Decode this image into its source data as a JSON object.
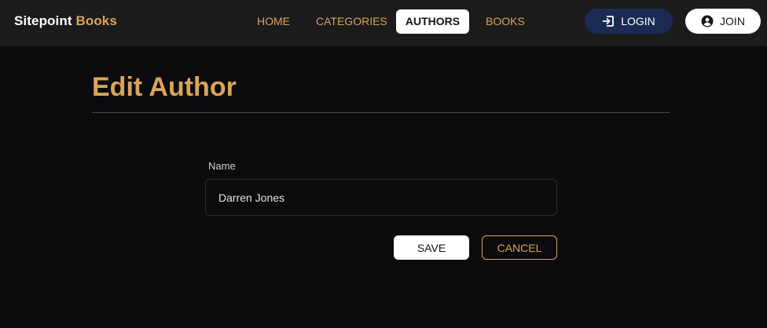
{
  "brand": {
    "name": "Sitepoint",
    "accent": "Books"
  },
  "nav": {
    "home": "HOME",
    "categories": "CATEGORIES",
    "authors": "AUTHORS",
    "books": "BOOKS",
    "active": "AUTHORS"
  },
  "auth": {
    "login_label": "LOGIN",
    "login_icon": "login-icon",
    "join_label": "JOIN",
    "join_icon": "account-circle-icon"
  },
  "page": {
    "title": "Edit Author"
  },
  "form": {
    "name_label": "Name",
    "name_value": "Darren Jones",
    "save_label": "SAVE",
    "cancel_label": "CANCEL"
  },
  "colors": {
    "accent": "#d9a55a",
    "navbar": "#1b1b1b",
    "background": "#0b0a0d",
    "login_button": "#1a2a52"
  }
}
